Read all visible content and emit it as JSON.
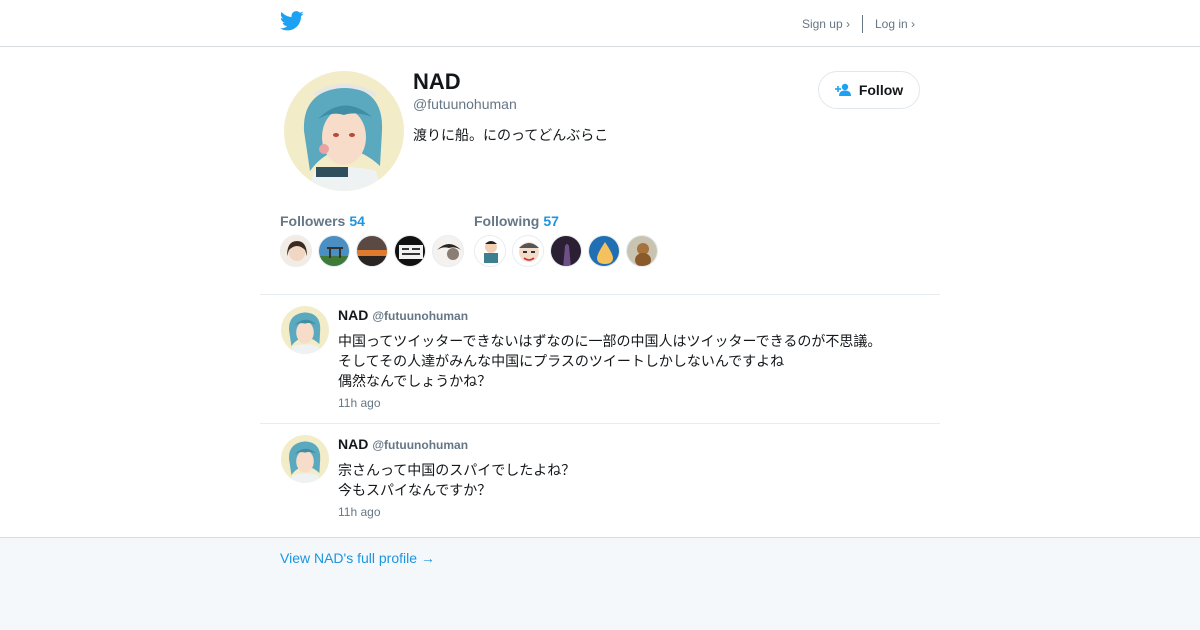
{
  "header": {
    "signup_label": "Sign up ›",
    "login_label": "Log in ›"
  },
  "profile": {
    "name": "NAD",
    "handle": "@futuunohuman",
    "bio": "渡りに船。にのってどんぶらこ",
    "follow_label": "Follow",
    "followers_label": "Followers",
    "followers_count": "54",
    "following_label": "Following",
    "following_count": "57"
  },
  "tweets": [
    {
      "name": "NAD",
      "handle": "@futuunohuman",
      "lines": [
        "中国ってツイッターできないはずなのに一部の中国人はツイッターできるのが不思議。",
        "そしてその人達がみんな中国にプラスのツイートしかしないんですよね",
        "偶然なんでしょうかね？"
      ],
      "time": "11h ago"
    },
    {
      "name": "NAD",
      "handle": "@futuunohuman",
      "lines": [
        "宗さんって中国のスパイでしたよね？",
        "今もスパイなんですか？"
      ],
      "time": "11h ago"
    }
  ],
  "footer": {
    "full_profile_link": "View NAD's full profile →"
  },
  "colors": {
    "accent": "#1b95e0",
    "bird": "#1da1f2",
    "muted": "#657786",
    "footer_bg": "#f5f8fa"
  }
}
